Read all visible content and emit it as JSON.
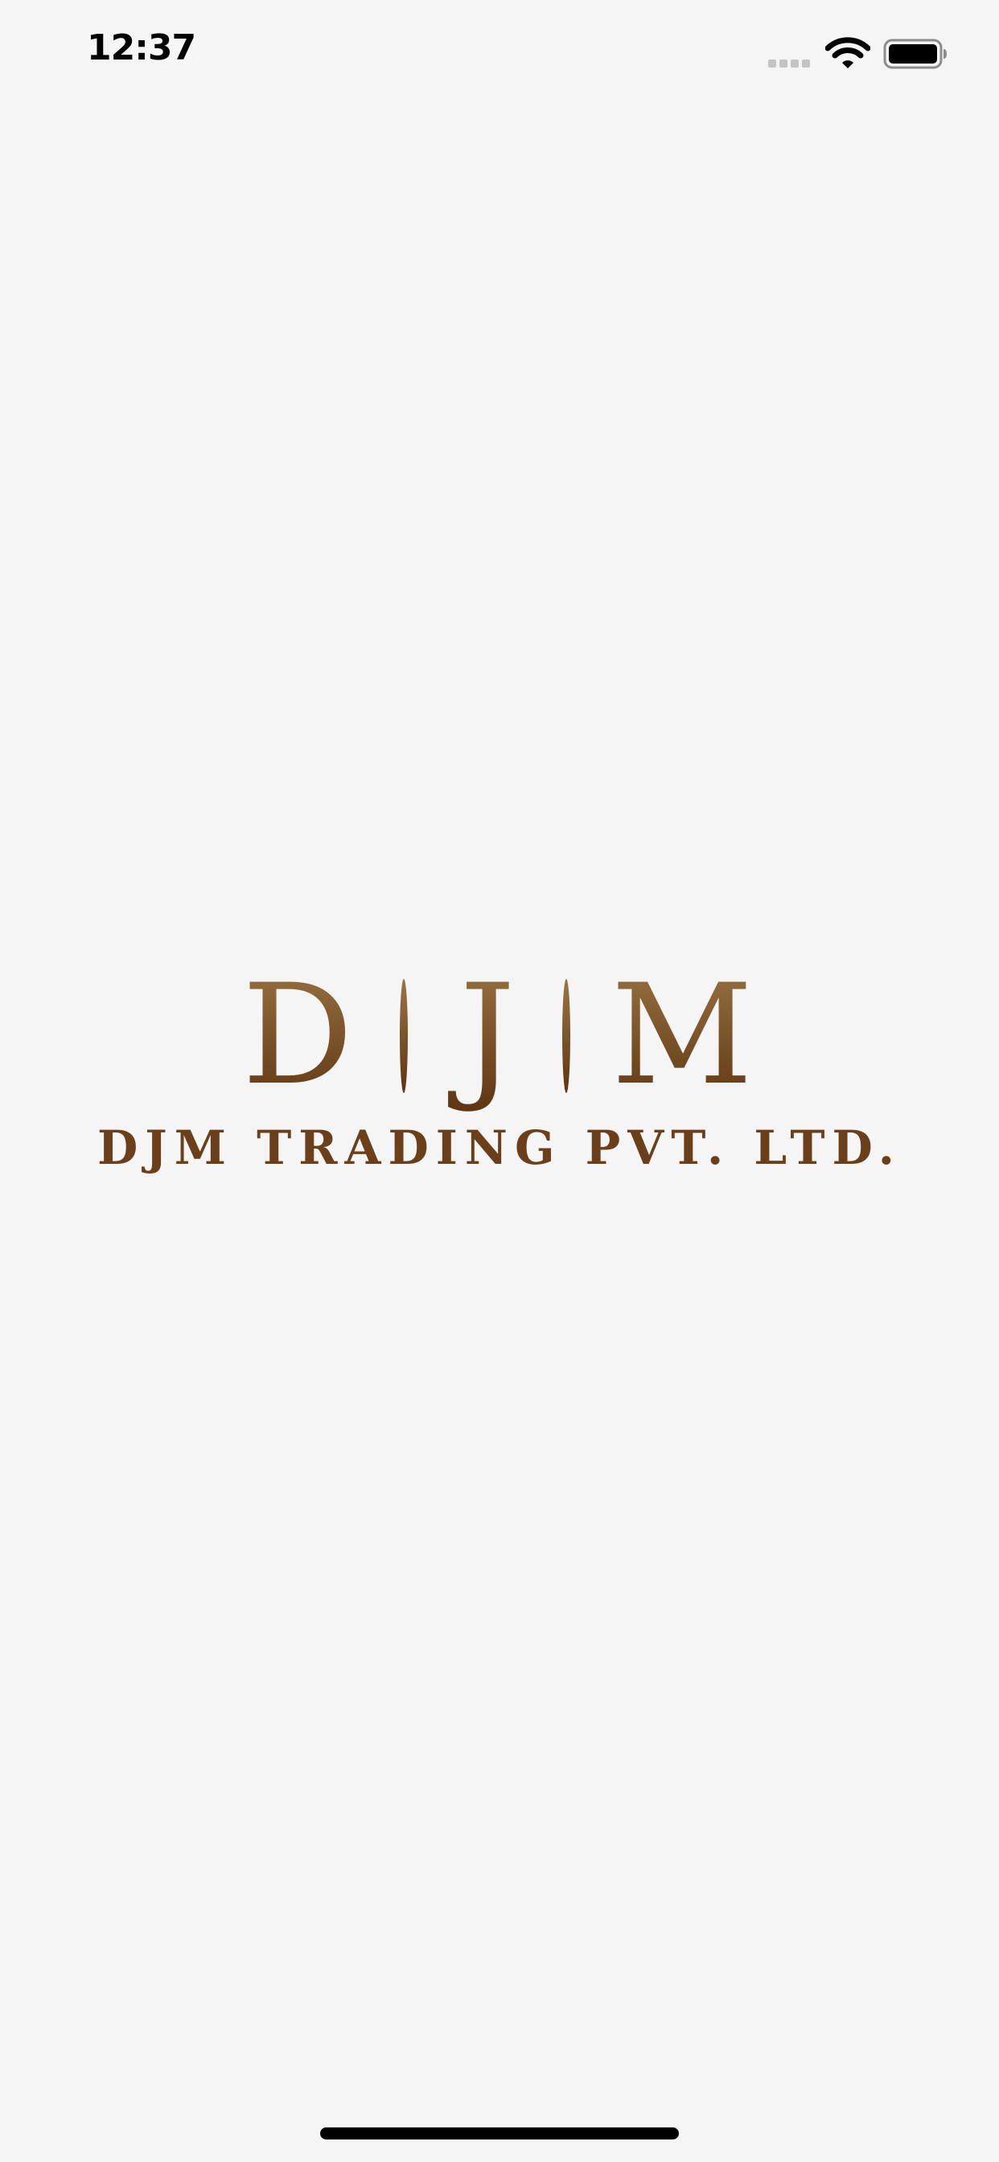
{
  "status_bar": {
    "time": "12:37",
    "icons": [
      "cellular-signal-icon",
      "wifi-icon",
      "battery-icon"
    ],
    "battery_level": 1.0
  },
  "logo": {
    "letters": [
      "D",
      "J",
      "M"
    ],
    "company_name": "DJM TRADING PVT. LTD.",
    "colors": {
      "gradient_top": "#9a7544",
      "gradient_bottom": "#5e3411",
      "text": "#6b3f1a"
    }
  },
  "background_color": "#f5f5f5"
}
